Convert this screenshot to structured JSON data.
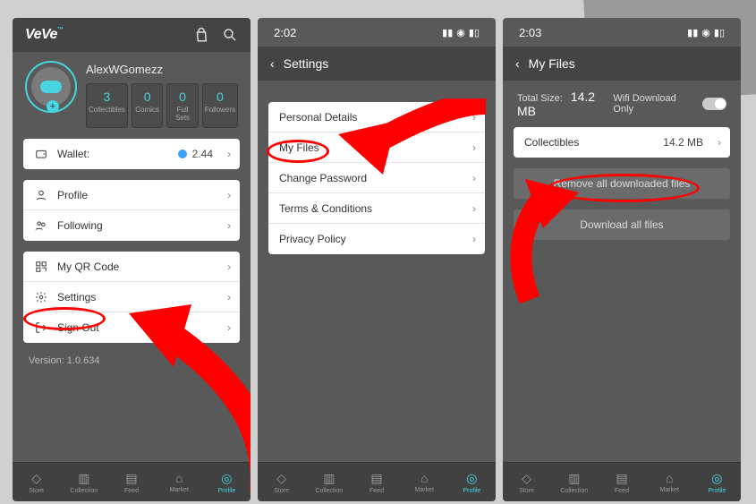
{
  "phone1": {
    "logo": "VeVe",
    "logo_tm": "™",
    "username": "AlexWGomezz",
    "stats": [
      {
        "val": "3",
        "lbl": "Collectibles"
      },
      {
        "val": "0",
        "lbl": "Comics"
      },
      {
        "val": "0",
        "lbl": "Full Sets"
      },
      {
        "val": "0",
        "lbl": "Followers"
      }
    ],
    "wallet_label": "Wallet:",
    "wallet_value": "2.44",
    "menu": {
      "profile": "Profile",
      "following": "Following",
      "qr": "My QR Code",
      "settings": "Settings",
      "signout": "Sign Out"
    },
    "version": "Version: 1.0.634"
  },
  "phone2": {
    "time": "2:02",
    "header": "Settings",
    "items": {
      "personal": "Personal Details",
      "myfiles": "My Files",
      "password": "Change Password",
      "terms": "Terms & Conditions",
      "privacy": "Privacy Policy"
    }
  },
  "phone3": {
    "time": "2:03",
    "header": "My Files",
    "total_label": "Total Size:",
    "total_value": "14.2 MB",
    "wifi_label": "Wifi Download Only",
    "row_label": "Collectibles",
    "row_value": "14.2 MB",
    "remove_btn": "Remove all downloaded files",
    "download_btn": "Download all files"
  },
  "tabs": [
    {
      "lbl": "Store"
    },
    {
      "lbl": "Collection"
    },
    {
      "lbl": "Feed"
    },
    {
      "lbl": "Market"
    },
    {
      "lbl": "Profile"
    }
  ]
}
